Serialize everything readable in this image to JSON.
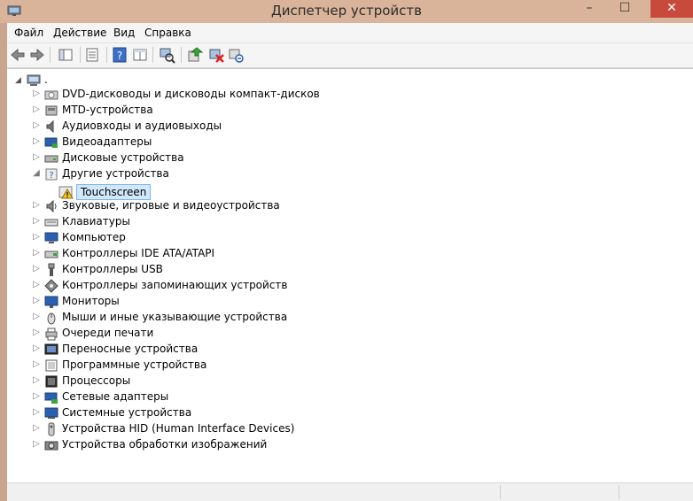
{
  "window": {
    "title": "Диспетчер устройств",
    "close_glyph": "✕",
    "minimize_glyph": "–",
    "maximize_glyph": "☐"
  },
  "menu": [
    "Файл",
    "Действие",
    "Вид",
    "Справка"
  ],
  "toolbar_icons": [
    "back-icon",
    "forward-icon",
    "console-tree-icon",
    "properties-icon",
    "help-icon",
    "view-icon",
    "scan-hardware-icon",
    "update-driver-icon",
    "disable-device-icon",
    "uninstall-device-icon"
  ],
  "tree": {
    "root_label": ".",
    "categories": [
      {
        "label": "DVD-дисководы и дисководы компакт-дисков",
        "icon": "dvd-drive-icon",
        "expanded": false
      },
      {
        "label": "MTD-устройства",
        "icon": "mtd-device-icon",
        "expanded": false
      },
      {
        "label": "Аудиовходы и аудиовыходы",
        "icon": "speaker-icon",
        "expanded": false
      },
      {
        "label": "Видеоадаптеры",
        "icon": "display-adapter-icon",
        "expanded": false
      },
      {
        "label": "Дисковые устройства",
        "icon": "disk-drive-icon",
        "expanded": false
      },
      {
        "label": "Другие устройства",
        "icon": "unknown-device-icon",
        "expanded": true
      },
      {
        "label": "Звуковые, игровые и видеоустройства",
        "icon": "sound-device-icon",
        "expanded": false
      },
      {
        "label": "Клавиатуры",
        "icon": "keyboard-icon",
        "expanded": false
      },
      {
        "label": "Компьютер",
        "icon": "computer-icon",
        "expanded": false
      },
      {
        "label": "Контроллеры IDE ATA/ATAPI",
        "icon": "ide-controller-icon",
        "expanded": false
      },
      {
        "label": "Контроллеры USB",
        "icon": "usb-icon",
        "expanded": false
      },
      {
        "label": "Контроллеры запоминающих устройств",
        "icon": "storage-controller-icon",
        "expanded": false
      },
      {
        "label": "Мониторы",
        "icon": "monitor-icon",
        "expanded": false
      },
      {
        "label": "Мыши и иные указывающие устройства",
        "icon": "mouse-icon",
        "expanded": false
      },
      {
        "label": "Очереди печати",
        "icon": "printer-icon",
        "expanded": false
      },
      {
        "label": "Переносные устройства",
        "icon": "portable-device-icon",
        "expanded": false
      },
      {
        "label": "Программные устройства",
        "icon": "software-device-icon",
        "expanded": false
      },
      {
        "label": "Процессоры",
        "icon": "processor-icon",
        "expanded": false
      },
      {
        "label": "Сетевые адаптеры",
        "icon": "network-adapter-icon",
        "expanded": false
      },
      {
        "label": "Системные устройства",
        "icon": "system-device-icon",
        "expanded": false
      },
      {
        "label": "Устройства HID (Human Interface Devices)",
        "icon": "hid-device-icon",
        "expanded": false
      },
      {
        "label": "Устройства обработки изображений",
        "icon": "imaging-device-icon",
        "expanded": false
      }
    ],
    "child": {
      "label": "Touchscreen",
      "icon": "warning-device-icon"
    }
  }
}
